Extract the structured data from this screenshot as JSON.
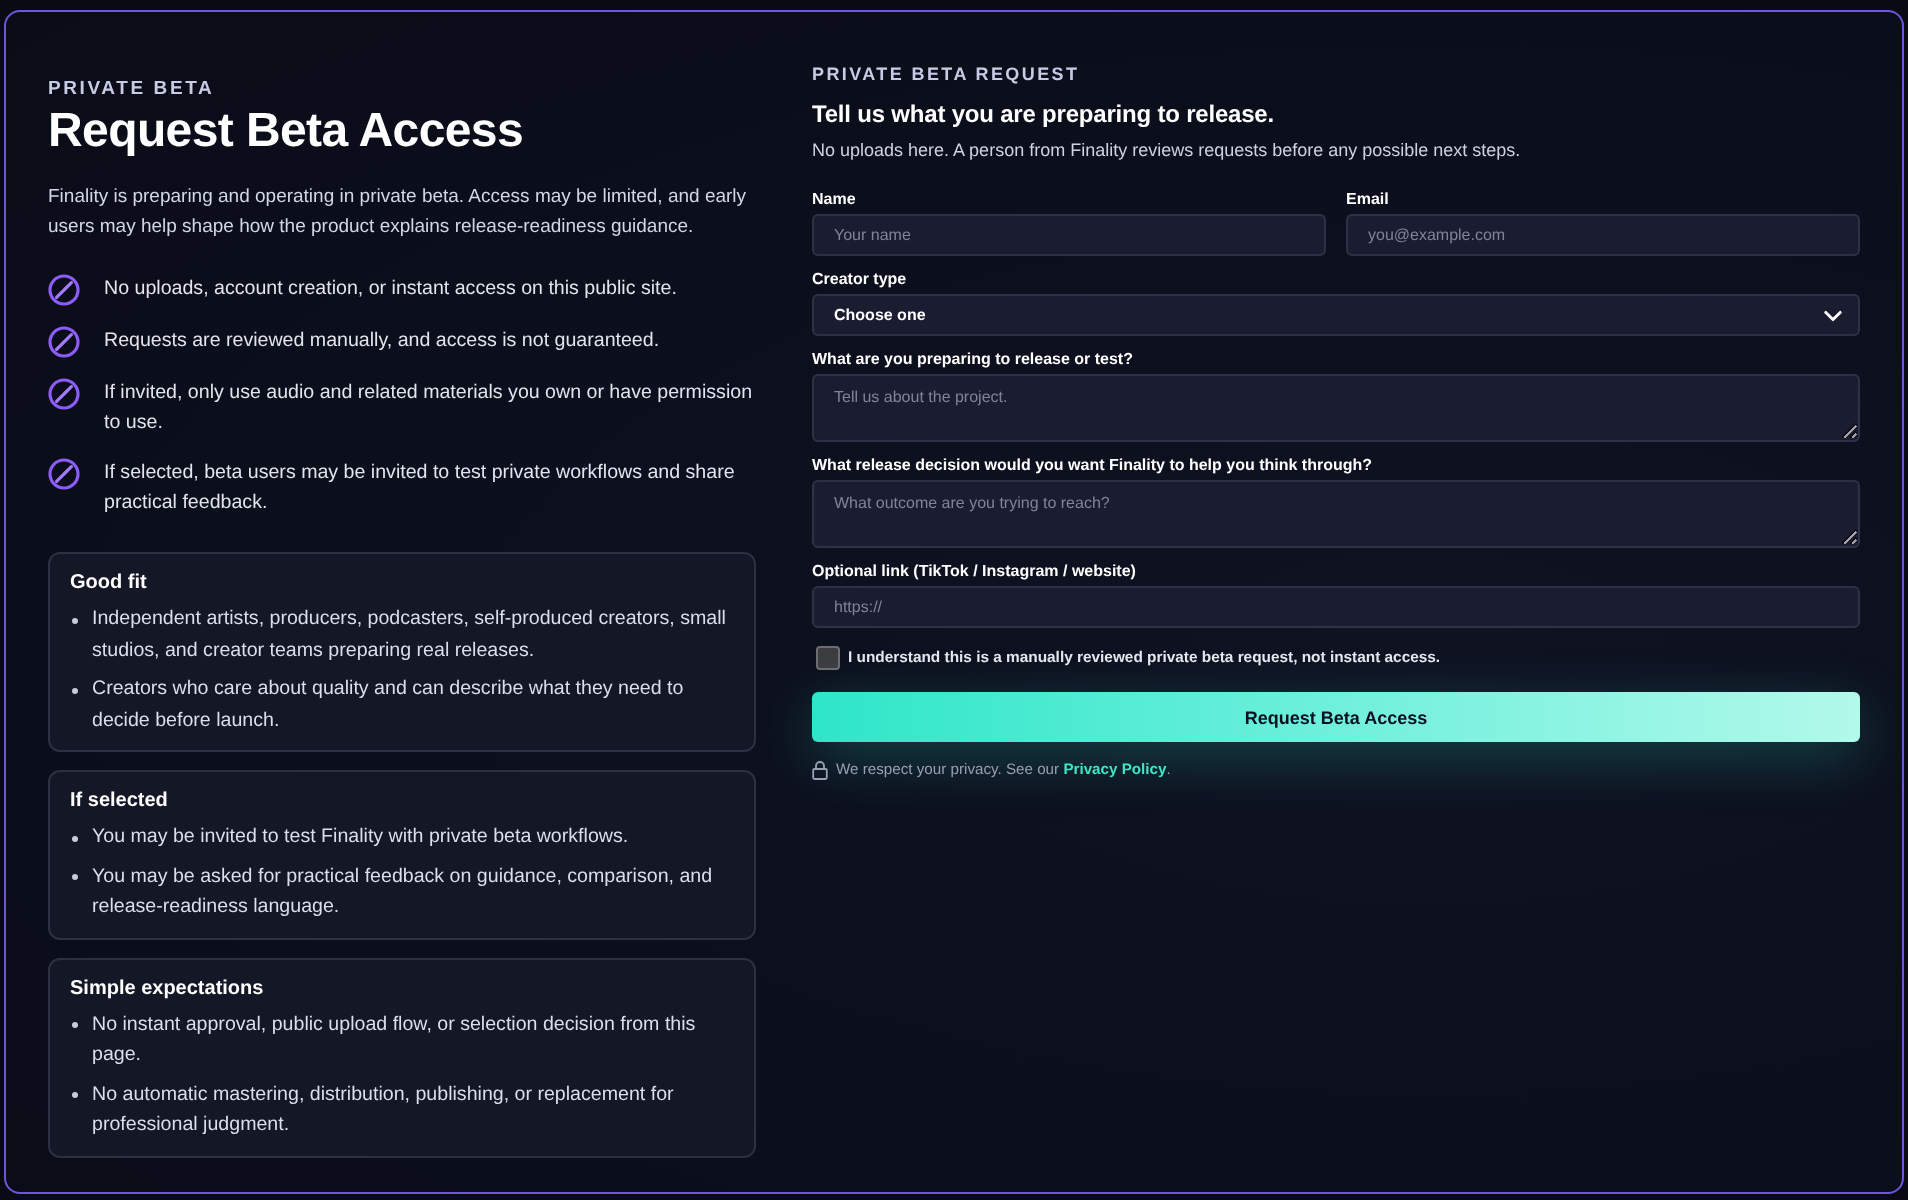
{
  "intro": {
    "eyebrow": "PRIVATE BETA",
    "title": "Request Beta Access",
    "description": "Finality is preparing and operating in private beta. Access may be limited, and early users may help shape how the product explains release-readiness guidance."
  },
  "notices": [
    "No uploads, account creation, or instant access on this public site.",
    "Requests are reviewed manually, and access is not guaranteed.",
    "If invited, only use audio and related materials you own or have permission to use.",
    "If selected, beta users may be invited to test private workflows and share practical feedback."
  ],
  "cards": [
    {
      "title": "Good fit",
      "items": [
        "Independent artists, producers, podcasters, self-produced creators, small studios, and creator teams preparing real releases.",
        "Creators who care about quality and can describe what they need to decide before launch."
      ]
    },
    {
      "title": "If selected",
      "items": [
        "You may be invited to test Finality with private beta workflows.",
        "You may be asked for practical feedback on guidance, comparison, and release-readiness language."
      ]
    },
    {
      "title": "Simple expectations",
      "items": [
        "No instant approval, public upload flow, or selection decision from this page.",
        "No automatic mastering, distribution, publishing, or replacement for professional judgment."
      ]
    }
  ],
  "form": {
    "eyebrow": "PRIVATE BETA REQUEST",
    "title": "Tell us what you are preparing to release.",
    "subtitle": "No uploads here. A person from Finality reviews requests before any possible next steps.",
    "rows": [
      {
        "fields": [
          {
            "kind": "input",
            "label": "Name",
            "placeholder": "Your name"
          },
          {
            "kind": "input",
            "label": "Email",
            "placeholder": "you@example.com"
          }
        ]
      },
      {
        "fields": [
          {
            "kind": "select",
            "label": "Creator type",
            "value": "Choose one"
          }
        ]
      },
      {
        "fields": [
          {
            "kind": "textarea",
            "label": "What are you preparing to release or test?",
            "placeholder": "Tell us about the project."
          }
        ]
      },
      {
        "fields": [
          {
            "kind": "textarea",
            "label": "What release decision would you want Finality to help you think through?",
            "placeholder": "What outcome are you trying to reach?"
          }
        ]
      },
      {
        "fields": [
          {
            "kind": "input",
            "label": "Optional link (TikTok / Instagram / website)",
            "placeholder": "https://"
          }
        ]
      }
    ],
    "consent": {
      "label": "I understand this is a manually reviewed private beta request, not instant access.",
      "checked": false
    },
    "submit": "Request Beta Access",
    "privacy": {
      "text": "We respect your privacy. See our",
      "link": "Privacy Policy",
      "after": "."
    }
  }
}
